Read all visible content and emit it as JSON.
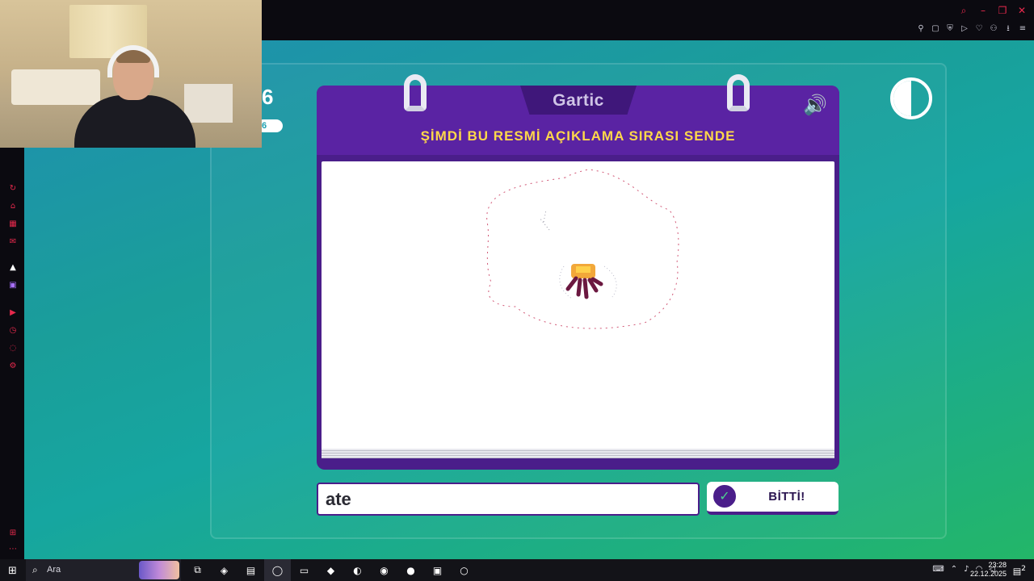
{
  "game": {
    "logo": "Gartic",
    "prompt": "ŞİMDİ BU RESMİ AÇIKLAMA SIRASI SENDE",
    "round_current": "6",
    "round_total": "6",
    "answer_value": "ate",
    "done_label": "BİTTİ!",
    "timer_fraction_remaining": 0.5
  },
  "taskbar": {
    "search_label": "Ara",
    "time": "23:28",
    "date": "22.12.2025",
    "notifications": "2"
  },
  "colors": {
    "card": "#4a1e8a",
    "prompt": "#ffd84a",
    "bg_left": "#1f8fb0",
    "bg_right": "#23b668",
    "accent": "#e8294d"
  },
  "icons": {
    "start": "windows-icon",
    "search": "search-icon",
    "sound": "speaker-icon",
    "check": "check-icon"
  }
}
